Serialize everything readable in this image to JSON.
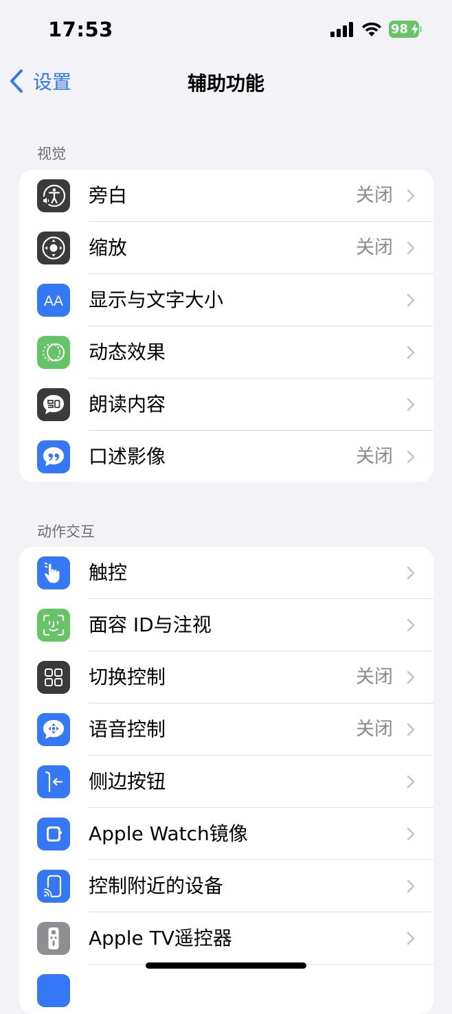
{
  "status": {
    "time": "17:53",
    "battery": "98",
    "battery_color": "#65C466"
  },
  "nav": {
    "back_label": "设置",
    "title": "辅助功能",
    "accent": "#3478F6"
  },
  "sections": {
    "vision": {
      "header": "视觉",
      "items": [
        {
          "label": "旁白",
          "value": "关闭",
          "icon": "voiceover-icon",
          "icon_color": "#3A3A3C"
        },
        {
          "label": "缩放",
          "value": "关闭",
          "icon": "zoom-icon",
          "icon_color": "#3A3A3C"
        },
        {
          "label": "显示与文字大小",
          "value": "",
          "icon": "text-size-icon",
          "icon_color": "#3478F6"
        },
        {
          "label": "动态效果",
          "value": "",
          "icon": "motion-icon",
          "icon_color": "#65C466"
        },
        {
          "label": "朗读内容",
          "value": "",
          "icon": "spoken-content-icon",
          "icon_color": "#3A3A3C"
        },
        {
          "label": "口述影像",
          "value": "关闭",
          "icon": "audio-description-icon",
          "icon_color": "#3478F6"
        }
      ]
    },
    "interaction": {
      "header": "动作交互",
      "items": [
        {
          "label": "触控",
          "value": "",
          "icon": "touch-icon",
          "icon_color": "#3478F6"
        },
        {
          "label": "面容 ID与注视",
          "value": "",
          "icon": "face-id-icon",
          "icon_color": "#65C466"
        },
        {
          "label": "切换控制",
          "value": "关闭",
          "icon": "switch-control-icon",
          "icon_color": "#3A3A3C"
        },
        {
          "label": "语音控制",
          "value": "关闭",
          "icon": "voice-control-icon",
          "icon_color": "#3478F6"
        },
        {
          "label": "侧边按钮",
          "value": "",
          "icon": "side-button-icon",
          "icon_color": "#3478F6"
        },
        {
          "label": "Apple Watch镜像",
          "value": "",
          "icon": "apple-watch-mirroring-icon",
          "icon_color": "#3478F6"
        },
        {
          "label": "控制附近的设备",
          "value": "",
          "icon": "nearby-devices-icon",
          "icon_color": "#3478F6"
        },
        {
          "label": "Apple TV遥控器",
          "value": "",
          "icon": "apple-tv-remote-icon",
          "icon_color": "#8E8E93"
        }
      ]
    }
  }
}
